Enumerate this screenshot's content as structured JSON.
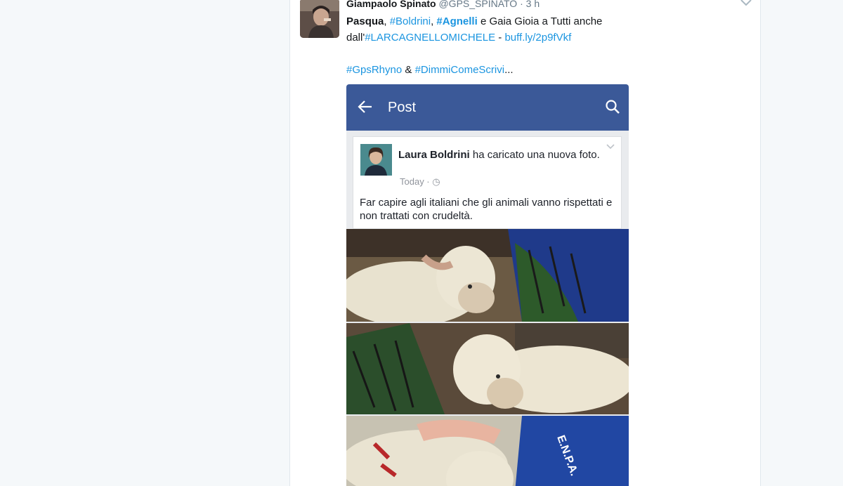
{
  "tweet": {
    "fullname": "Giampaolo Spinato",
    "handle": "@GPS_SPINATO",
    "separator": "·",
    "time": "3 h",
    "text": {
      "t1": "Pasqua",
      "t2": ", ",
      "tag_boldrini": "#Boldrini",
      "t3": ", ",
      "tag_agnelli": "#Agnelli",
      "t4": " e Gaia Gioia a Tutti anche",
      "t5": "dall'",
      "tag_larcagnello": "#LARCAGNELLOMICHELE",
      "t6": " - ",
      "link": "buff.ly/2p9fVkf",
      "tag_gpsrhyno": "#GpsRhyno",
      "t7": " & ",
      "tag_dimmi": "#DimmiComeScrivi",
      "t8": "..."
    }
  },
  "fb": {
    "bar_title": "Post",
    "author": "Laura Boldrini",
    "action": " ha caricato una nuova foto.",
    "meta": "Today · ◷",
    "caption": "Far capire agli italiani che gli animali vanno rispettati e non trattati con crudeltà."
  },
  "colors": {
    "link": "#1b95e0",
    "fb_blue": "#3b5998",
    "page_bg": "#f5f8fa"
  },
  "icons": [
    "chevron-down-icon",
    "back-arrow-icon",
    "search-icon",
    "globe-icon"
  ]
}
